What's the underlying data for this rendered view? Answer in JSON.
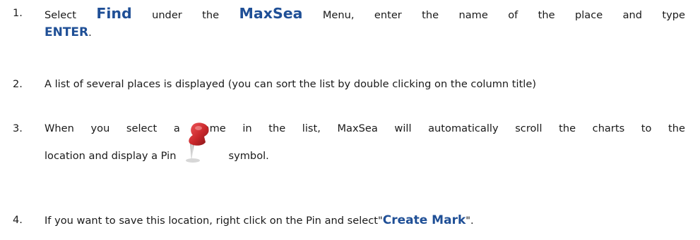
{
  "steps": [
    {
      "number": "1.",
      "t1": "Select ",
      "k1": "Find",
      "t2": " under the ",
      "k2": "MaxSea",
      "t3": " Menu, enter the name of the place and type",
      "k3": "ENTER",
      "t4": "."
    },
    {
      "number": "2.",
      "text": "A list of several places is displayed (you can sort the list by double clicking on the column title)"
    },
    {
      "number": "3.",
      "t1": "When you select a name in the list, MaxSea will automatically scroll the charts to the",
      "t2": "location and display a Pin",
      "t3": "symbol.",
      "icon": "pin-icon"
    },
    {
      "number": "4.",
      "t1": "If you want to save this location, right click on the Pin and select\"",
      "k1": "Create Mark",
      "t2": "\"."
    }
  ],
  "colors": {
    "keyword": "#1f4f96",
    "pin_head": "#c8262a"
  }
}
